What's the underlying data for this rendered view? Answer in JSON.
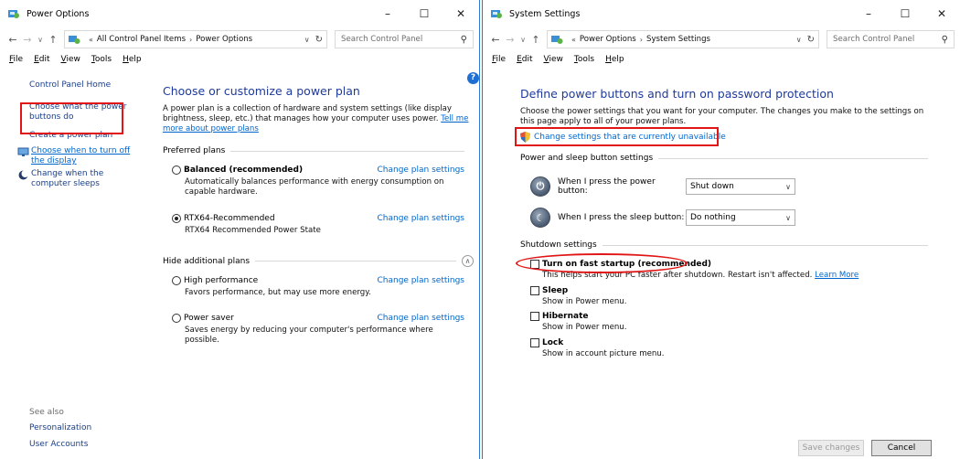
{
  "left": {
    "title": "Power Options",
    "address": {
      "crumb_prefix": "«",
      "crumb1": "All Control Panel Items",
      "crumb2": "Power Options",
      "search_placeholder": "Search Control Panel"
    },
    "menu": [
      {
        "ul": "F",
        "rest": "ile"
      },
      {
        "ul": "E",
        "rest": "dit"
      },
      {
        "ul": "V",
        "rest": "iew"
      },
      {
        "ul": "T",
        "rest": "ools"
      },
      {
        "ul": "H",
        "rest": "elp"
      }
    ],
    "sidebar": {
      "home": "Control Panel Home",
      "power_buttons": "Choose what the power buttons do",
      "create_plan": "Create a power plan",
      "turn_off_display": "Choose when to turn off the display",
      "sleep": "Change when the computer sleeps"
    },
    "see_also": {
      "header": "See also",
      "personalization": "Personalization",
      "user_accounts": "User Accounts"
    },
    "heading": "Choose or customize a power plan",
    "description": "A power plan is a collection of hardware and system settings (like display brightness, sleep, etc.) that manages how your computer uses power.",
    "tell_me_more": "Tell me more about power plans",
    "preferred_header": "Preferred plans",
    "hide_header": "Hide additional plans",
    "change_label": "Change plan settings",
    "plans": [
      {
        "name": "Balanced (recommended)",
        "desc": "Automatically balances performance with energy consumption on capable hardware.",
        "selected": false,
        "bold": true
      },
      {
        "name": "RTX64-Recommended",
        "desc": "RTX64 Recommended Power State",
        "selected": true,
        "bold": false
      },
      {
        "name": "High performance",
        "desc": "Favors performance, but may use more energy.",
        "selected": false,
        "bold": false
      },
      {
        "name": "Power saver",
        "desc": "Saves energy by reducing your computer's performance where possible.",
        "selected": false,
        "bold": false
      }
    ]
  },
  "right": {
    "title": "System Settings",
    "address": {
      "crumb_prefix": "«",
      "crumb1": "Power Options",
      "crumb2": "System Settings",
      "search_placeholder": "Search Control Panel"
    },
    "menu": [
      {
        "ul": "F",
        "rest": "ile"
      },
      {
        "ul": "E",
        "rest": "dit"
      },
      {
        "ul": "V",
        "rest": "iew"
      },
      {
        "ul": "T",
        "rest": "ools"
      },
      {
        "ul": "H",
        "rest": "elp"
      }
    ],
    "heading": "Define power buttons and turn on password protection",
    "description": "Choose the power settings that you want for your computer. The changes you make to the settings on this page apply to all of your power plans.",
    "change_unavailable": "Change settings that are currently unavailable",
    "power_sleep_header": "Power and sleep button settings",
    "power_button_label": "When I press the power button:",
    "power_button_value": "Shut down",
    "sleep_button_label": "When I press the sleep button:",
    "sleep_button_value": "Do nothing",
    "shutdown_header": "Shutdown settings",
    "fast_startup": "Turn on fast startup (recommended)",
    "fast_startup_desc": "This helps start your PC faster after shutdown. Restart isn't affected.",
    "learn_more": "Learn More",
    "sleep_opt": "Sleep",
    "sleep_desc": "Show in Power menu.",
    "hibernate_opt": "Hibernate",
    "hibernate_desc": "Show in Power menu.",
    "lock_opt": "Lock",
    "lock_desc": "Show in account picture menu.",
    "save": "Save changes",
    "cancel": "Cancel"
  },
  "icons": {
    "control_panel": "control-panel-icon",
    "shield": "uac-shield-icon",
    "power": "power-button-icon",
    "sleep": "sleep-button-icon"
  },
  "colors": {
    "heading_blue": "#1e3a9c",
    "link_blue": "#0066cc",
    "highlight_red": "#e11515",
    "window_border": "#2b79d8"
  }
}
